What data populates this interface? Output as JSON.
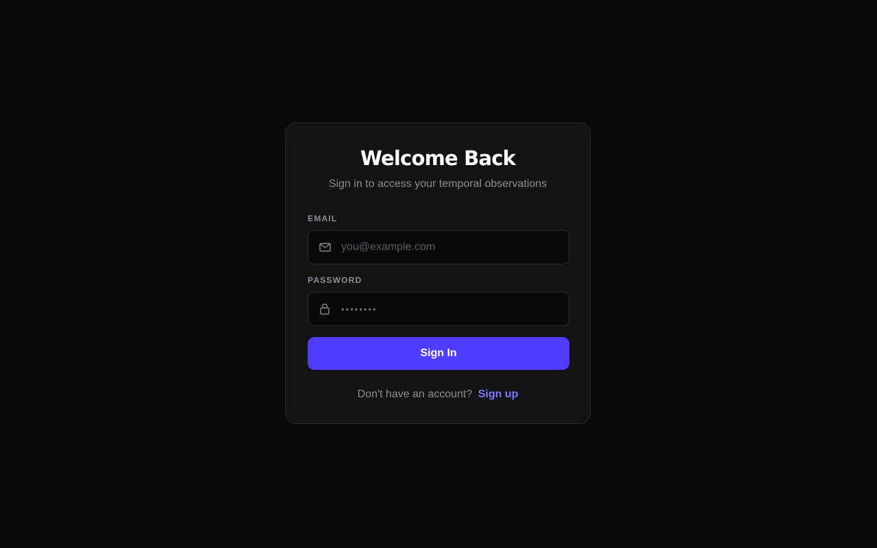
{
  "login": {
    "title": "Welcome Back",
    "subtitle": "Sign in to access your temporal observations",
    "email": {
      "label": "EMAIL",
      "placeholder": "you@example.com",
      "value": ""
    },
    "password": {
      "label": "PASSWORD",
      "masked_value": "••••••••"
    },
    "sign_in_label": "Sign In",
    "footer_prompt": "Don't have an account?",
    "signup_label": "Sign up"
  },
  "colors": {
    "background": "#09090b",
    "card": "#131316",
    "input": "#08080a",
    "accent": "#4f3cff",
    "link": "#7b78ff",
    "text_primary": "#ffffff",
    "text_muted": "#8b8b95"
  },
  "icons": {
    "email": "mail-icon",
    "password": "lock-icon"
  }
}
